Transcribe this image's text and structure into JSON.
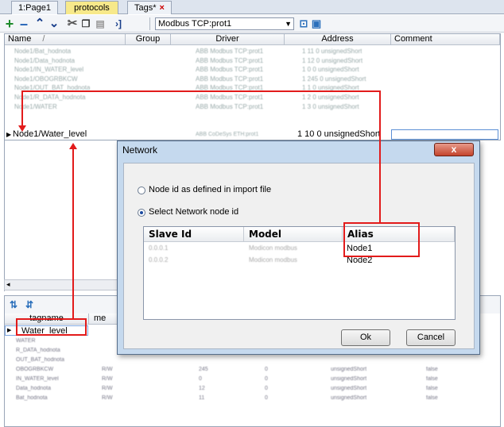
{
  "tabs": [
    {
      "label": "1:Page1",
      "active": false
    },
    {
      "label": "protocols",
      "active": true
    },
    {
      "label": "Tags*",
      "active": false,
      "close": "×"
    }
  ],
  "toolbar": {
    "driver_select": "Modbus TCP:prot1"
  },
  "grid": {
    "columns": [
      "Name",
      "Group",
      "Driver",
      "Address",
      "Comment"
    ],
    "rows": [
      {
        "name": "Node1/Bat_hodnota",
        "driver": "ABB Modbus TCP:prot1",
        "address": "1  11 0 unsignedShort"
      },
      {
        "name": "Node1/Data_hodnota",
        "driver": "ABB Modbus TCP:prot1",
        "address": "1  12 0 unsignedShort"
      },
      {
        "name": "Node1/IN_WATER_level",
        "driver": "ABB Modbus TCP:prot1",
        "address": "1  0 0 unsignedShort"
      },
      {
        "name": "Node1/OBOGRBKCW",
        "driver": "ABB Modbus TCP:prot1",
        "address": "1  245 0 unsignedShort"
      },
      {
        "name": "Node1/OUT_BAT_hodnota",
        "driver": "ABB Modbus TCP:prot1",
        "address": "1  1 0 unsignedShort"
      },
      {
        "name": "Node1/R_DATA_hodnota",
        "driver": "ABB Modbus TCP:prot1",
        "address": "1  2 0 unsignedShort"
      },
      {
        "name": "Node1/WATER",
        "driver": "ABB Modbus TCP:prot1",
        "address": "1  3 0 unsignedShort"
      }
    ],
    "selected_row": {
      "name": "Node1/Water_level",
      "driver": "ABB CoDeSys ETH:prot1",
      "address": "1  10 0 unsignedShort"
    }
  },
  "bottom": {
    "columns": [
      "tagname",
      "me"
    ],
    "selected_tag": "Water_level",
    "rows": [
      {
        "tag": "WATER",
        "mode": "",
        "addr": "",
        "bit": "",
        "type": "",
        "flag": ""
      },
      {
        "tag": "R_DATA_hodnota",
        "mode": "",
        "addr": "",
        "bit": "",
        "type": "",
        "flag": ""
      },
      {
        "tag": "OUT_BAT_hodnota",
        "mode": "",
        "addr": "",
        "bit": "",
        "type": "",
        "flag": ""
      },
      {
        "tag": "OBOGRBKCW",
        "mode": "R/W",
        "addr": "245",
        "bit": "0",
        "type": "unsignedShort",
        "flag": "false"
      },
      {
        "tag": "IN_WATER_level",
        "mode": "R/W",
        "addr": "0",
        "bit": "0",
        "type": "unsignedShort",
        "flag": "false"
      },
      {
        "tag": "Data_hodnota",
        "mode": "R/W",
        "addr": "12",
        "bit": "0",
        "type": "unsignedShort",
        "flag": "false"
      },
      {
        "tag": "Bat_hodnota",
        "mode": "R/W",
        "addr": "11",
        "bit": "0",
        "type": "unsignedShort",
        "flag": "false"
      }
    ]
  },
  "dialog": {
    "title": "Network",
    "close_glyph": "x",
    "option1": "Node id as defined in import file",
    "option2": "Select Network node id",
    "columns": [
      "Slave Id",
      "Model",
      "Alias"
    ],
    "rows": [
      {
        "slave": "0.0.0.1",
        "model": "Modicon modbus",
        "alias": "Node1"
      },
      {
        "slave": "0.0.0.2",
        "model": "Modicon modbus",
        "alias": "Node2"
      }
    ],
    "ok": "Ok",
    "cancel": "Cancel"
  },
  "colors": {
    "highlight": "#e21b1b",
    "active_tab": "#f7e98a",
    "dialog_frame": "#c5d9ee"
  }
}
